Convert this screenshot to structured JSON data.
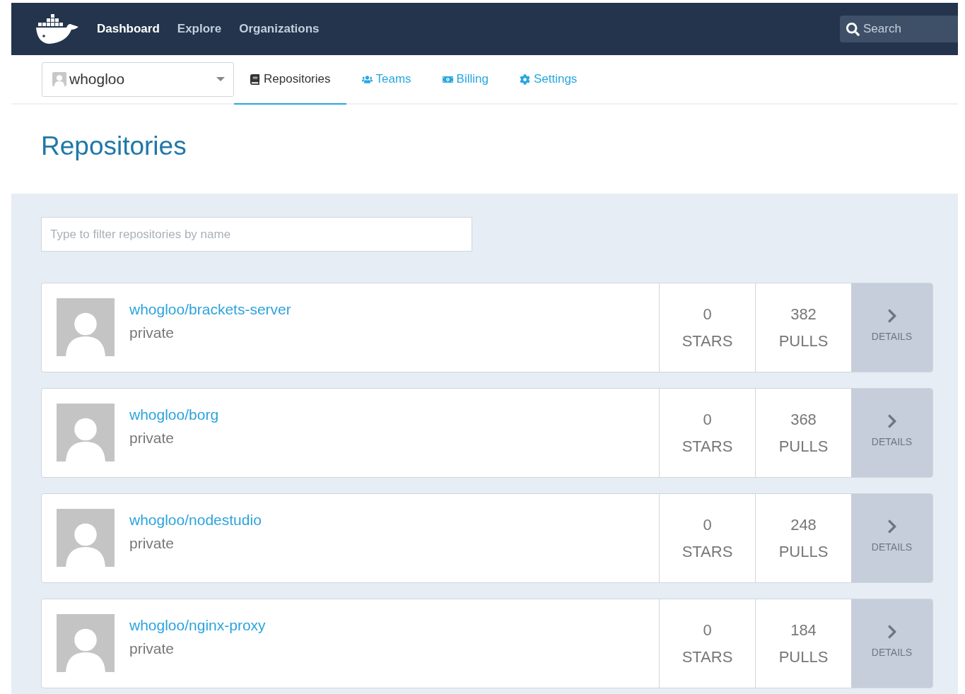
{
  "topnav": {
    "links": [
      {
        "label": "Dashboard",
        "selected": true
      },
      {
        "label": "Explore",
        "selected": false
      },
      {
        "label": "Organizations",
        "selected": false
      }
    ],
    "search": {
      "placeholder": "Search"
    }
  },
  "subnav": {
    "account": "whogloo",
    "tabs": [
      {
        "label": "Repositories",
        "selected": true
      },
      {
        "label": "Teams",
        "selected": false
      },
      {
        "label": "Billing",
        "selected": false
      },
      {
        "label": "Settings",
        "selected": false
      }
    ]
  },
  "title": "Repositories",
  "filter": {
    "placeholder": "Type to filter repositories by name"
  },
  "repositories": [
    {
      "name": "whogloo/brackets-server",
      "visibility": "private",
      "stars": "0",
      "stars_label": "STARS",
      "pulls": "382",
      "pulls_label": "PULLS",
      "details": "DETAILS"
    },
    {
      "name": "whogloo/borg",
      "visibility": "private",
      "stars": "0",
      "stars_label": "STARS",
      "pulls": "368",
      "pulls_label": "PULLS",
      "details": "DETAILS"
    },
    {
      "name": "whogloo/nodestudio",
      "visibility": "private",
      "stars": "0",
      "stars_label": "STARS",
      "pulls": "248",
      "pulls_label": "PULLS",
      "details": "DETAILS"
    },
    {
      "name": "whogloo/nginx-proxy",
      "visibility": "private",
      "stars": "0",
      "stars_label": "STARS",
      "pulls": "184",
      "pulls_label": "PULLS",
      "details": "DETAILS"
    }
  ]
}
